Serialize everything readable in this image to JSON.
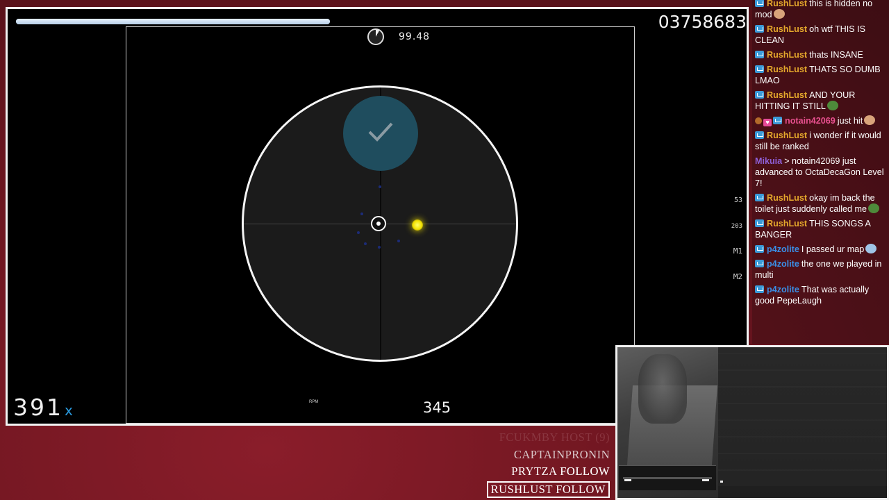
{
  "game": {
    "score": "03758683",
    "accuracy": "99.48",
    "combo": "391",
    "combo_suffix": "x",
    "rpm_label": "RPM",
    "rpm_value": "345",
    "hp_fraction": 0.41,
    "key_counters": [
      "53",
      "203",
      "M1",
      "M2"
    ]
  },
  "chat": {
    "messages": [
      {
        "badges": [
          "sub"
        ],
        "name": "RushLust",
        "color": "#e5a82c",
        "text": "this is hidden no mod",
        "emote": "emote-face-icon"
      },
      {
        "badges": [
          "sub"
        ],
        "name": "RushLust",
        "color": "#e5a82c",
        "text": "oh wtf THIS IS CLEAN"
      },
      {
        "badges": [
          "sub"
        ],
        "name": "RushLust",
        "color": "#e5a82c",
        "text": "thats INSANE"
      },
      {
        "badges": [
          "sub"
        ],
        "name": "RushLust",
        "color": "#e5a82c",
        "text": "THATS SO DUMB LMAO"
      },
      {
        "badges": [
          "sub"
        ],
        "name": "RushLust",
        "color": "#e5a82c",
        "text": "AND YOUR HITTING IT STILL",
        "emote": "pepe-emote-icon"
      },
      {
        "badges": [
          "cookie",
          "heart",
          "sub"
        ],
        "name": "notain42069",
        "color": "#e8508f",
        "text": "just hit",
        "emote": "face-emote-icon"
      },
      {
        "badges": [
          "sub"
        ],
        "name": "RushLust",
        "color": "#e5a82c",
        "text": "i wonder if it would still be ranked"
      },
      {
        "badges": [],
        "name": "Mikuia",
        "color": "#8e5fd6",
        "text": "> notain42069 just advanced to OctaDecaGon Level 7!"
      },
      {
        "badges": [
          "sub"
        ],
        "name": "RushLust",
        "color": "#e5a82c",
        "text": "okay im back the toilet just suddenly called me",
        "emote": "pepe-emote-icon"
      },
      {
        "badges": [
          "sub"
        ],
        "name": "RushLust",
        "color": "#e5a82c",
        "text": "THIS SONGS A BANGER"
      },
      {
        "badges": [
          "sub"
        ],
        "name": "p4zolite",
        "color": "#3a8ee6",
        "text": "I passed ur map",
        "emote": "anime-emote-icon"
      },
      {
        "badges": [
          "sub"
        ],
        "name": "p4zolite",
        "color": "#3a8ee6",
        "text": "the one we played in multi"
      },
      {
        "badges": [
          "sub"
        ],
        "name": "p4zolite",
        "color": "#3a8ee6",
        "text": "That was actually good PepeLaugh"
      }
    ]
  },
  "notices": [
    "FCUKMBY  HOST (9)",
    "CAPTAINPRONIN  FOLLOW",
    "PRYTZA  FOLLOW",
    "RUSHLUST  FOLLOW"
  ]
}
